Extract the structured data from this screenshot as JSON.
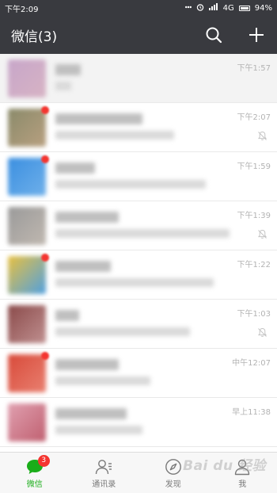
{
  "status_bar": {
    "time": "下午2:09",
    "network": "4G",
    "battery": "94%"
  },
  "header": {
    "title": "微信(3)"
  },
  "chats": [
    {
      "time": "下午1:57",
      "muted": false,
      "unread_dot": false,
      "avatar_colors": [
        "#c7a6c9",
        "#d7b3c4"
      ]
    },
    {
      "time": "下午2:07",
      "muted": true,
      "unread_dot": true,
      "avatar_colors": [
        "#8a8a6a",
        "#b8a080"
      ]
    },
    {
      "time": "下午1:59",
      "muted": false,
      "unread_dot": true,
      "avatar_colors": [
        "#3b8fe0",
        "#6fb0ea"
      ]
    },
    {
      "time": "下午1:39",
      "muted": true,
      "unread_dot": false,
      "avatar_colors": [
        "#9a9a9a",
        "#c0b8b0"
      ]
    },
    {
      "time": "下午1:22",
      "muted": false,
      "unread_dot": true,
      "avatar_colors": [
        "#e8c040",
        "#50a0e0"
      ]
    },
    {
      "time": "下午1:03",
      "muted": true,
      "unread_dot": false,
      "avatar_colors": [
        "#8a4a4a",
        "#c09090"
      ]
    },
    {
      "time": "中午12:07",
      "muted": false,
      "unread_dot": true,
      "avatar_colors": [
        "#d84a3a",
        "#e98070"
      ]
    },
    {
      "time": "早上11:38",
      "muted": false,
      "unread_dot": false,
      "avatar_colors": [
        "#e0a0b0",
        "#c06070"
      ]
    }
  ],
  "tabs": [
    {
      "label": "微信",
      "icon": "chat-bubble-icon",
      "active": true,
      "badge": "3"
    },
    {
      "label": "通讯录",
      "icon": "contacts-icon",
      "active": false
    },
    {
      "label": "发现",
      "icon": "compass-icon",
      "active": false
    },
    {
      "label": "我",
      "icon": "person-icon",
      "active": false
    }
  ],
  "watermark": "Bai du 经验",
  "colors": {
    "header_bg": "#393a3f",
    "active_green": "#1aad19",
    "badge_red": "#f43530"
  }
}
